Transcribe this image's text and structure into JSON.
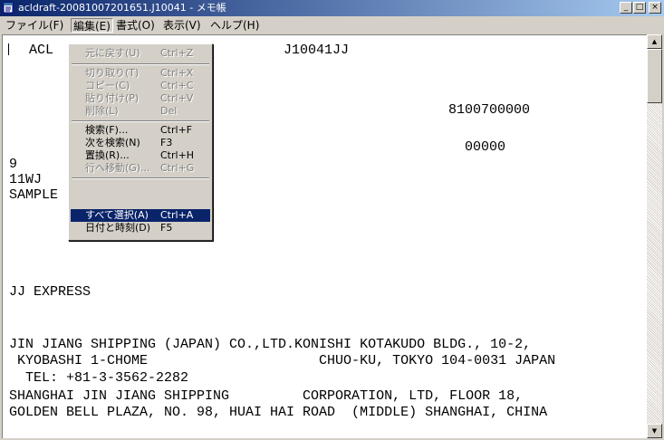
{
  "window": {
    "title": "acldraft-20081007201651.J10041 - メモ帳",
    "icon": "notepad-icon"
  },
  "menubar": [
    "ファイル(F)",
    "編集(E)",
    "書式(O)",
    "表示(V)",
    "ヘルプ(H)"
  ],
  "edit_menu": {
    "items": [
      {
        "label": "元に戻す(U)",
        "shortcut": "Ctrl+Z",
        "enabled": false
      },
      {
        "label": "切り取り(T)",
        "shortcut": "Ctrl+X",
        "enabled": false
      },
      {
        "label": "コピー(C)",
        "shortcut": "Ctrl+C",
        "enabled": false
      },
      {
        "label": "貼り付け(P)",
        "shortcut": "Ctrl+V",
        "enabled": false
      },
      {
        "label": "削除(L)",
        "shortcut": "Del",
        "enabled": false
      },
      {
        "label": "検索(F)...",
        "shortcut": "Ctrl+F",
        "enabled": true
      },
      {
        "label": "次を検索(N)",
        "shortcut": "F3",
        "enabled": true
      },
      {
        "label": "置換(R)...",
        "shortcut": "Ctrl+H",
        "enabled": true
      },
      {
        "label": "行へ移動(G)...",
        "shortcut": "Ctrl+G",
        "enabled": false
      },
      {
        "label": "すべて選択(A)",
        "shortcut": "Ctrl+A",
        "enabled": true,
        "highlighted": true
      },
      {
        "label": "日付と時刻(D)",
        "shortcut": "F5",
        "enabled": true
      }
    ]
  },
  "document": {
    "lines": [
      "ACL",
      "J10041JJ",
      "8100700000",
      "00000",
      "9",
      "11WJ",
      "SAMPLE",
      "JJ EXPRESS",
      "JIN JIANG SHIPPING (JAPAN) CO.,LTD.KONISHI KOTAKUDO BLDG., 10-2,",
      " KYOBASHI 1-CHOME                     CHUO-KU, TOKYO 104-0031 JAPAN",
      "  TEL: +81-3-3562-2282",
      "SHANGHAI JIN JIANG SHIPPING         CORPORATION, LTD, FLOOR 18,",
      "GOLDEN BELL PLAZA, NO. 98, HUAI HAI ROAD  (MIDDLE) SHANGHAI, CHINA"
    ]
  },
  "controls": {
    "minimize": "_",
    "maximize": "□",
    "close": "×",
    "scroll_up": "▲",
    "scroll_down": "▼"
  }
}
